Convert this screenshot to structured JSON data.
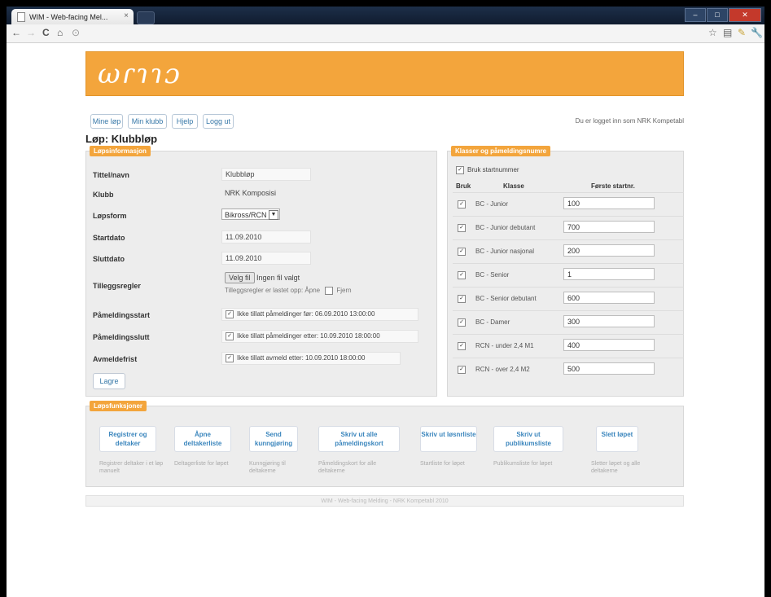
{
  "browser": {
    "tab_title": "WIM - Web-facing Mel...",
    "tab_close": "×",
    "window_controls": [
      "–",
      "□",
      "✕"
    ],
    "nav": {
      "back": "←",
      "forward": "→",
      "reload": "C",
      "home": "⌂",
      "info": "⊙"
    },
    "tools": [
      "☆",
      "▤",
      "✎",
      "🔧"
    ]
  },
  "header": {
    "logo_text": "ωɾɿɿɔ"
  },
  "menu": {
    "items": [
      "Mine løp",
      "Min klubb",
      "Hjelp",
      "Logg ut"
    ],
    "logged_in": "Du er logget inn som NRK Kompetabl"
  },
  "page_title": "Løp: Klubbløp",
  "race_panel": {
    "tag": "Løpsinformasjon",
    "fields": [
      {
        "label": "Tittel/navn",
        "value": "Klubbløp"
      },
      {
        "label": "Klubb",
        "value": "NRK Komposisi"
      },
      {
        "label": "Løpsform",
        "value": "Bikross/RCN"
      },
      {
        "label": "Startdato",
        "value": "11.09.2010"
      },
      {
        "label": "Sluttdato",
        "value": "11.09.2010"
      },
      {
        "label": "Tilleggsregler",
        "value": "Velg fil",
        "extra": "Ingen fil valgt",
        "note": "Tilleggsregler er lastet opp: Åpne",
        "note_chk": "Fjern"
      },
      {
        "label": "Påmeldingsstart",
        "value": "Ikke tillatt påmeldinger før: 06.09.2010 13:00:00"
      },
      {
        "label": "Påmeldingsslutt",
        "value": "Ikke tillatt påmeldinger etter: 10.09.2010 18:00:00"
      },
      {
        "label": "Avmeldefrist",
        "value": "Ikke tillatt avmeld etter: 10.09.2010 18:00:00"
      }
    ],
    "save_label": "Lagre"
  },
  "class_panel": {
    "tag": "Klasser og påmeldingsnumre",
    "use_label": "Bruk startnummer",
    "headers": {
      "use": "Bruk",
      "class": "Klasse",
      "first": "Første startnr."
    },
    "rows": [
      {
        "name": "BC - Junior",
        "value": "100"
      },
      {
        "name": "BC - Junior debutant",
        "value": "700"
      },
      {
        "name": "BC - Junior nasjonal",
        "value": "200"
      },
      {
        "name": "BC - Senior",
        "value": "1"
      },
      {
        "name": "BC - Senior debutant",
        "value": "600"
      },
      {
        "name": "BC - Damer",
        "value": "300"
      },
      {
        "name": "RCN - under 2,4 M1",
        "value": "400"
      },
      {
        "name": "RCN - over 2,4 M2",
        "value": "500"
      }
    ]
  },
  "actions_panel": {
    "tag": "Løpsfunksjoner",
    "buttons": [
      {
        "label": "Registrer og deltaker",
        "desc": "Registrer deltaker i et løp manuelt"
      },
      {
        "label": "Åpne deltakerliste",
        "desc": "Deltagerliste for løpet"
      },
      {
        "label": "Send kunngjøring",
        "desc": "Kunngjøring til deltakerne"
      },
      {
        "label": "Skriv ut alle påmeldingskort",
        "desc": "Påmeldingskort for alle deltakerne"
      },
      {
        "label": "Skriv ut løsnrliste",
        "desc": "Startliste for løpet"
      },
      {
        "label": "Skriv ut publikumsliste",
        "desc": "Publikumsliste for løpet"
      },
      {
        "label": "Slett løpet",
        "desc": "Sletter løpet og alle deltakerne"
      }
    ]
  },
  "footer": {
    "text": "WIM - Web-facing Melding - NRK Kompetabl 2010"
  },
  "colors": {
    "accent": "#f3a53c",
    "link": "#3778a8"
  }
}
